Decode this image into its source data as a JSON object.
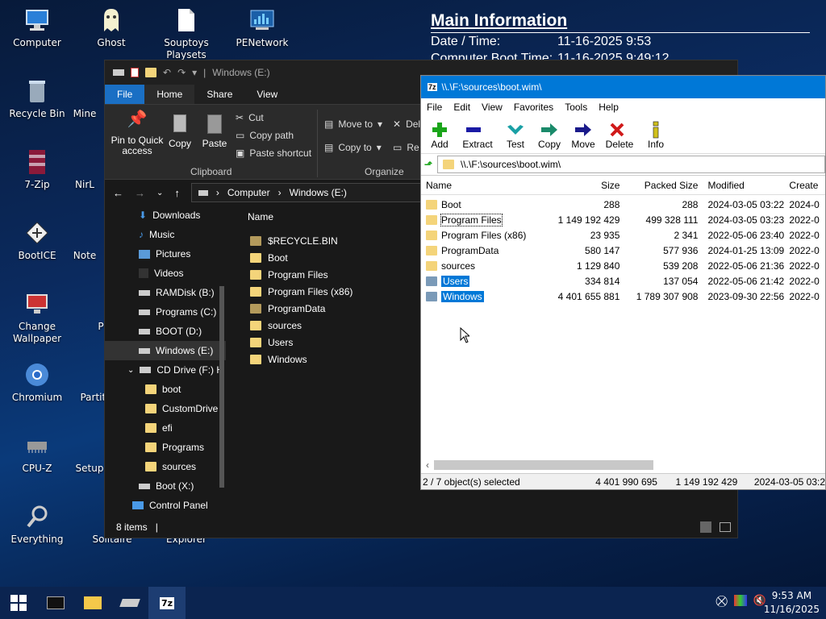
{
  "desktop": {
    "icons": [
      {
        "label": "Computer",
        "icon": "computer-icon"
      },
      {
        "label": "Ghost",
        "icon": "ghost-icon"
      },
      {
        "label": "Souptoys Playsets",
        "icon": "document-icon"
      },
      {
        "label": "PENetwork",
        "icon": "network-icon"
      },
      {
        "label": "Recycle Bin",
        "icon": "recycle-bin-icon"
      },
      {
        "label": "Mine",
        "icon": "minesweeper-icon"
      },
      {
        "label": "7-Zip",
        "icon": "7zip-icon"
      },
      {
        "label": "NirL",
        "icon": "nirlauncher-icon"
      },
      {
        "label": "BootICE",
        "icon": "bootice-icon"
      },
      {
        "label": "Note",
        "icon": "notepad-icon"
      },
      {
        "label": "Change Wallpaper",
        "icon": "wallpaper-icon"
      },
      {
        "label": "P",
        "icon": "app-icon"
      },
      {
        "label": "Chromium",
        "icon": "chromium-icon"
      },
      {
        "label": "Partiti",
        "icon": "partition-icon"
      },
      {
        "label": "CPU-Z",
        "icon": "cpuz-icon"
      },
      {
        "label": "Setup",
        "icon": "setup-icon"
      },
      {
        "label": "Everything",
        "icon": "search-icon"
      },
      {
        "label": "Solitaire",
        "icon": "solitaire-icon"
      },
      {
        "label": "Explorer",
        "icon": "explorer-icon"
      }
    ]
  },
  "info": {
    "title": "Main Information",
    "rows": [
      {
        "label": "Date / Time:",
        "value": "11-16-2025 9:53"
      },
      {
        "label": "Computer Boot Time:",
        "value": "11-16-2025 9:49:12"
      }
    ]
  },
  "explorer": {
    "title": "Windows (E:)",
    "tabs": [
      "File",
      "Home",
      "Share",
      "View"
    ],
    "ribbon": {
      "pin": "Pin to Quick access",
      "copy": "Copy",
      "paste": "Paste",
      "cut": "Cut",
      "copy_path": "Copy path",
      "paste_shortcut": "Paste shortcut",
      "clipboard": "Clipboard",
      "move_to": "Move to",
      "copy_to": "Copy to",
      "delete": "Del",
      "rename": "Re",
      "organize": "Organize"
    },
    "breadcrumb": [
      "Computer",
      "Windows (E:)"
    ],
    "nav": [
      {
        "label": "Downloads",
        "icon": "download-icon"
      },
      {
        "label": "Music",
        "icon": "music-icon"
      },
      {
        "label": "Pictures",
        "icon": "pictures-icon"
      },
      {
        "label": "Videos",
        "icon": "videos-icon"
      },
      {
        "label": "RAMDisk (B:)",
        "icon": "drive-icon"
      },
      {
        "label": "Programs (C:)",
        "icon": "drive-icon"
      },
      {
        "label": "BOOT (D:)",
        "icon": "drive-icon"
      },
      {
        "label": "Windows (E:)",
        "icon": "drive-icon"
      },
      {
        "label": "CD Drive (F:) H",
        "icon": "cd-drive-icon"
      },
      {
        "label": "boot",
        "icon": "folder-icon"
      },
      {
        "label": "CustomDrive",
        "icon": "folder-icon"
      },
      {
        "label": "efi",
        "icon": "folder-icon"
      },
      {
        "label": "Programs",
        "icon": "folder-icon"
      },
      {
        "label": "sources",
        "icon": "folder-icon"
      },
      {
        "label": "Boot (X:)",
        "icon": "drive-icon"
      },
      {
        "label": "Control Panel",
        "icon": "control-panel-icon"
      }
    ],
    "column_name": "Name",
    "files": [
      {
        "name": "$RECYCLE.BIN",
        "dark": true
      },
      {
        "name": "Boot",
        "dark": false
      },
      {
        "name": "Program Files",
        "dark": false
      },
      {
        "name": "Program Files (x86)",
        "dark": false
      },
      {
        "name": "ProgramData",
        "dark": true
      },
      {
        "name": "sources",
        "dark": false
      },
      {
        "name": "Users",
        "dark": false
      },
      {
        "name": "Windows",
        "dark": false
      }
    ],
    "status": "8 items"
  },
  "sevenzip": {
    "title": "\\\\.\\F:\\sources\\boot.wim\\",
    "menu": [
      "File",
      "Edit",
      "View",
      "Favorites",
      "Tools",
      "Help"
    ],
    "tools": [
      {
        "label": "Add",
        "color": "#1aa51a"
      },
      {
        "label": "Extract",
        "color": "#1a1aa5"
      },
      {
        "label": "Test",
        "color": "#1aa0a5"
      },
      {
        "label": "Copy",
        "color": "#1a8a6a"
      },
      {
        "label": "Move",
        "color": "#1a1a8a"
      },
      {
        "label": "Delete",
        "color": "#d01a1a"
      },
      {
        "label": "Info",
        "color": "#d0c01a"
      }
    ],
    "path": "\\\\.\\F:\\sources\\boot.wim\\",
    "columns": [
      "Name",
      "Size",
      "Packed Size",
      "Modified",
      "Create"
    ],
    "rows": [
      {
        "name": "Boot",
        "size": "288",
        "packed": "288",
        "modified": "2024-03-05 03:22",
        "created": "2024-0",
        "selected": false
      },
      {
        "name": "Program Files",
        "size": "1 149 192 429",
        "packed": "499 328 111",
        "modified": "2024-03-05 03:23",
        "created": "2022-0",
        "selected": false
      },
      {
        "name": "Program Files (x86)",
        "size": "23 935",
        "packed": "2 341",
        "modified": "2022-05-06 23:40",
        "created": "2022-0",
        "selected": false
      },
      {
        "name": "ProgramData",
        "size": "580 147",
        "packed": "577 936",
        "modified": "2024-01-25 13:09",
        "created": "2022-0",
        "selected": false
      },
      {
        "name": "sources",
        "size": "1 129 840",
        "packed": "539 208",
        "modified": "2022-05-06 21:36",
        "created": "2022-0",
        "selected": false
      },
      {
        "name": "Users",
        "size": "334 814",
        "packed": "137 054",
        "modified": "2022-05-06 21:42",
        "created": "2022-0",
        "selected": true
      },
      {
        "name": "Windows",
        "size": "4 401 655 881",
        "packed": "1 789 307 908",
        "modified": "2023-09-30 22:56",
        "created": "2022-0",
        "selected": true
      }
    ],
    "status": {
      "selected": "2 / 7 object(s) selected",
      "size": "4 401 990 695",
      "packed": "1 149 192 429",
      "modified": "2024-03-05 03:2"
    }
  },
  "taskbar": {
    "time": "9:53 AM",
    "date": "11/16/2025"
  }
}
